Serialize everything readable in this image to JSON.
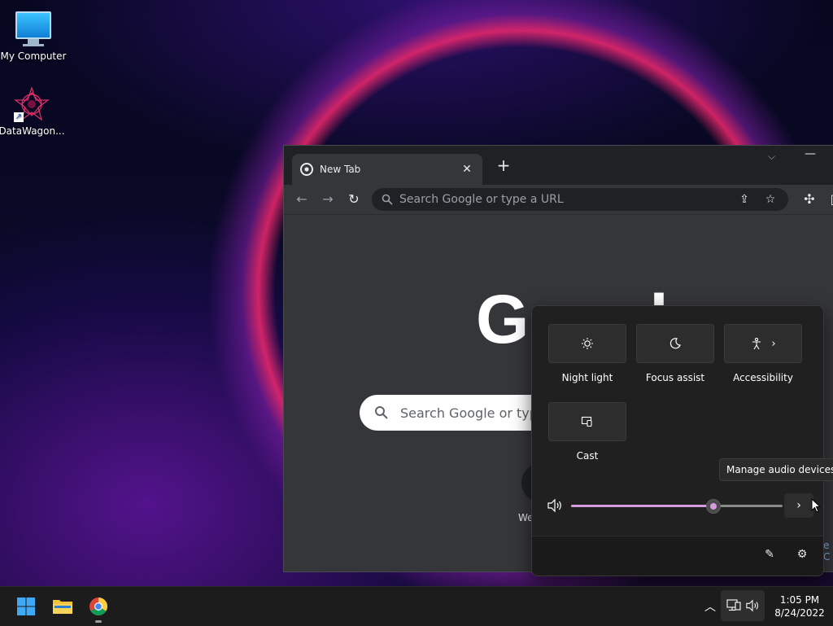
{
  "desktop": {
    "icons": [
      {
        "label": "My Computer"
      },
      {
        "label": "DataWagon..."
      }
    ]
  },
  "browser": {
    "tab_title": "New Tab",
    "tab_close": "✕",
    "new_tab": "+",
    "omnibox_placeholder": "Search Google or type a URL",
    "logo_text": "G",
    "logo_text_partial": "l",
    "ntp_search_placeholder": "Search Google or type",
    "shortcut_label": "We",
    "edge_text": "e C"
  },
  "quick_settings": {
    "tiles": [
      {
        "label": "Night light",
        "icon": "night-light-icon"
      },
      {
        "label": "Focus assist",
        "icon": "focus-assist-icon"
      },
      {
        "label": "Accessibility",
        "icon": "accessibility-icon"
      },
      {
        "label": "Cast",
        "icon": "cast-icon"
      }
    ],
    "volume_percent": 67,
    "tooltip": "Manage audio devices"
  },
  "taskbar": {
    "time": "1:05 PM",
    "date": "8/24/2022"
  },
  "colors": {
    "accent": "#d89be0",
    "flyout_bg": "#202020",
    "taskbar_bg": "#1c1c1c"
  }
}
